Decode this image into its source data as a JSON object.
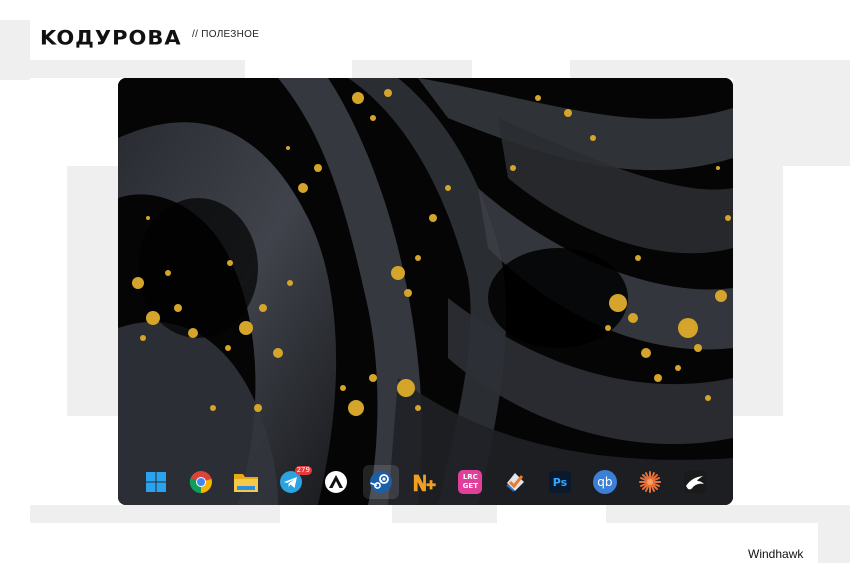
{
  "header": {
    "logo_text": "KOДУРОВА",
    "section_label": "// ПОЛЕЗНОЕ"
  },
  "caption": "Windhawk",
  "colors": {
    "wallpaper_gold": "#d4a52a",
    "wallpaper_dark": "#2a2d33",
    "background_block": "#efefef"
  },
  "taskbar": {
    "items": [
      {
        "name": "windows-start",
        "icon": "windows-logo-icon"
      },
      {
        "name": "chrome",
        "icon": "chrome-icon"
      },
      {
        "name": "file-explorer",
        "icon": "folder-icon"
      },
      {
        "name": "telegram",
        "icon": "telegram-icon",
        "badge": "279"
      },
      {
        "name": "app-a",
        "icon": "triangle-a-icon"
      },
      {
        "name": "steam",
        "icon": "steam-icon",
        "active": true
      },
      {
        "name": "notepad-plus",
        "icon": "n-plus-icon"
      },
      {
        "name": "lrcget",
        "icon": "lrcget-icon",
        "line1": "LRC",
        "line2": "GET"
      },
      {
        "name": "checklist",
        "icon": "checklist-icon"
      },
      {
        "name": "photoshop",
        "icon": "photoshop-icon",
        "label": "Ps"
      },
      {
        "name": "qbittorrent",
        "icon": "qbittorrent-icon",
        "label": "qb"
      },
      {
        "name": "starburst-app",
        "icon": "starburst-icon"
      },
      {
        "name": "eagle-app",
        "icon": "eagle-icon"
      }
    ]
  }
}
